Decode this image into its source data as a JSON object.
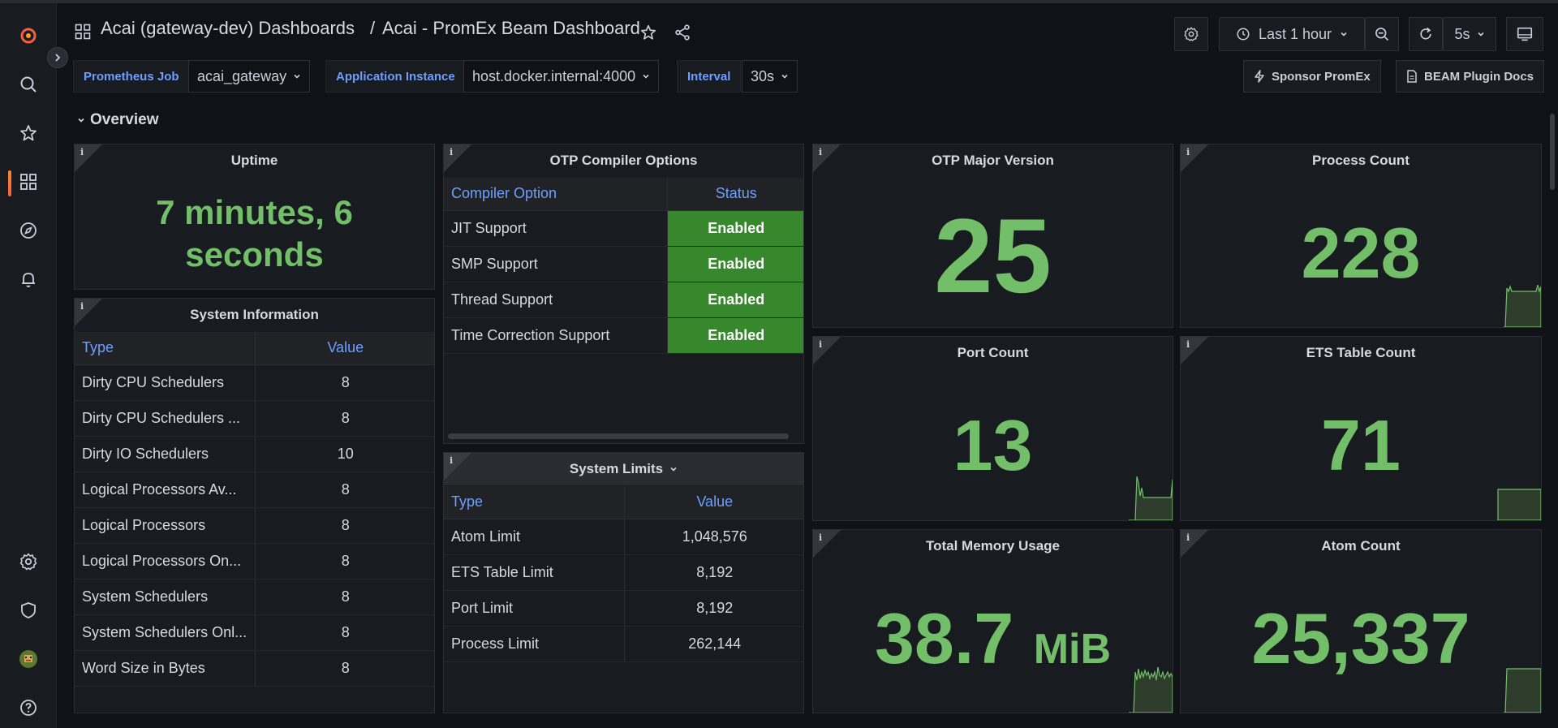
{
  "header": {
    "dashboards_crumb": "Acai (gateway-dev) Dashboards",
    "separator": "/",
    "dashboard_title": "Acai - PromEx Beam Dashboard",
    "time_range": "Last 1 hour",
    "refresh_interval": "5s"
  },
  "variables": {
    "prometheus_job_label": "Prometheus Job",
    "prometheus_job_value": "acai_gateway",
    "app_instance_label": "Application Instance",
    "app_instance_value": "host.docker.internal:4000",
    "interval_label": "Interval",
    "interval_value": "30s"
  },
  "links": {
    "sponsor": "Sponsor PromEx",
    "docs": "BEAM Plugin Docs"
  },
  "row": {
    "title": "Overview"
  },
  "panels": {
    "uptime": {
      "title": "Uptime",
      "value_line1": "7 minutes, 6",
      "value_line2": "seconds"
    },
    "otp_compiler": {
      "title": "OTP Compiler Options",
      "col_option": "Compiler Option",
      "col_status": "Status",
      "rows": [
        {
          "option": "JIT Support",
          "status": "Enabled"
        },
        {
          "option": "SMP Support",
          "status": "Enabled"
        },
        {
          "option": "Thread Support",
          "status": "Enabled"
        },
        {
          "option": "Time Correction Support",
          "status": "Enabled"
        }
      ]
    },
    "otp_major": {
      "title": "OTP Major Version",
      "value": "25"
    },
    "process_count": {
      "title": "Process Count",
      "value": "228"
    },
    "system_info": {
      "title": "System Information",
      "col_type": "Type",
      "col_value": "Value",
      "rows": [
        {
          "type": "Dirty CPU Schedulers",
          "value": "8"
        },
        {
          "type": "Dirty CPU Schedulers ...",
          "value": "8"
        },
        {
          "type": "Dirty IO Schedulers",
          "value": "10"
        },
        {
          "type": "Logical Processors Av...",
          "value": "8"
        },
        {
          "type": "Logical Processors",
          "value": "8"
        },
        {
          "type": "Logical Processors On...",
          "value": "8"
        },
        {
          "type": "System Schedulers",
          "value": "8"
        },
        {
          "type": "System Schedulers Onl...",
          "value": "8"
        },
        {
          "type": "Word Size in Bytes",
          "value": "8"
        }
      ]
    },
    "port_count": {
      "title": "Port Count",
      "value": "13"
    },
    "ets_table_count": {
      "title": "ETS Table Count",
      "value": "71"
    },
    "system_limits": {
      "title": "System Limits",
      "col_type": "Type",
      "col_value": "Value",
      "rows": [
        {
          "type": "Atom Limit",
          "value": "1,048,576"
        },
        {
          "type": "ETS Table Limit",
          "value": "8,192"
        },
        {
          "type": "Port Limit",
          "value": "8,192"
        },
        {
          "type": "Process Limit",
          "value": "262,144"
        }
      ]
    },
    "total_memory": {
      "title": "Total Memory Usage",
      "value": "38.7",
      "unit": "MiB"
    },
    "atom_count": {
      "title": "Atom Count",
      "value": "25,337"
    }
  },
  "info_icon": "i",
  "colors": {
    "stat_green": "#73bf69",
    "enabled_bg": "#37872d",
    "link_blue": "#6e9fff",
    "grafana_orange": "#f55f3e"
  },
  "icons": [
    "grafana-logo",
    "search-icon",
    "star-icon",
    "dashboards-icon",
    "explore-compass-icon",
    "bell-icon",
    "gear-icon",
    "shield-icon",
    "avatar",
    "help-icon",
    "clock-icon",
    "zoom-out-icon",
    "refresh-icon",
    "tv-icon",
    "share-icon",
    "bolt-icon",
    "document-icon"
  ]
}
